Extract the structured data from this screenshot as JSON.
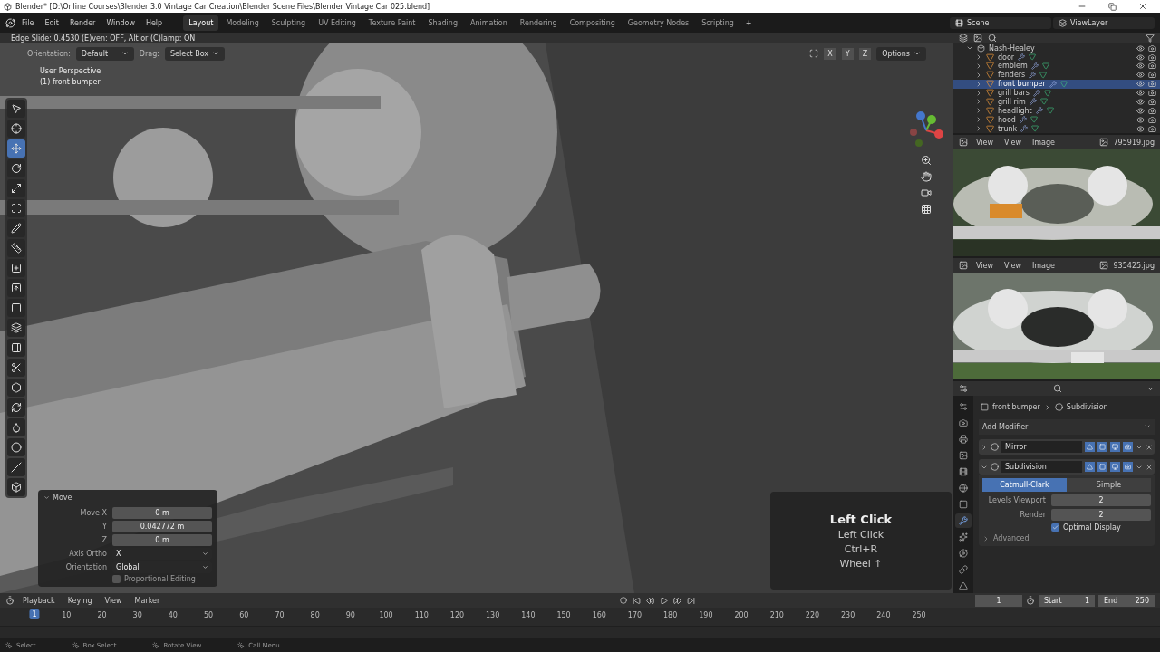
{
  "title_bar": {
    "title": "Blender* [D:\\Online Courses\\Blender 3.0 Vintage Car Creation\\Blender Scene Files\\Blender Vintage Car 025.blend]"
  },
  "menu": [
    "File",
    "Edit",
    "Render",
    "Window",
    "Help"
  ],
  "workspaces": [
    {
      "label": "Layout",
      "selected": true
    },
    {
      "label": "Modeling",
      "selected": false
    },
    {
      "label": "Sculpting",
      "selected": false
    },
    {
      "label": "UV Editing",
      "selected": false
    },
    {
      "label": "Texture Paint",
      "selected": false
    },
    {
      "label": "Shading",
      "selected": false
    },
    {
      "label": "Animation",
      "selected": false
    },
    {
      "label": "Rendering",
      "selected": false
    },
    {
      "label": "Compositing",
      "selected": false
    },
    {
      "label": "Geometry Nodes",
      "selected": false
    },
    {
      "label": "Scripting",
      "selected": false
    }
  ],
  "add_workspace": "+",
  "scene": "Scene",
  "view_layer": "ViewLayer",
  "viewport": {
    "status": "Edge Slide: 0.4530 (E)ven: OFF, Alt or (C)lamp: ON",
    "orientation_label": "Orientation:",
    "orientation": "Default",
    "drag_label": "Drag:",
    "drag": "Select Box",
    "axes": [
      "X",
      "Y",
      "Z"
    ],
    "options": "Options",
    "view_name": "User Perspective",
    "object_info": "(1) front bumper",
    "tools": [
      {
        "kind": "select",
        "selected": false
      },
      {
        "kind": "cursor",
        "selected": false
      },
      {
        "kind": "move",
        "selected": true
      },
      {
        "kind": "rotate",
        "selected": false
      },
      {
        "kind": "scale",
        "selected": false
      },
      {
        "kind": "transform",
        "selected": false
      },
      {
        "kind": "annotate",
        "selected": false
      },
      {
        "kind": "measure",
        "selected": false
      },
      {
        "kind": "add",
        "selected": false
      },
      {
        "kind": "extrude",
        "selected": false
      },
      {
        "kind": "inset",
        "selected": false
      },
      {
        "kind": "bevel",
        "selected": false
      },
      {
        "kind": "loopcut",
        "selected": false
      },
      {
        "kind": "knife",
        "selected": false
      },
      {
        "kind": "polybuild",
        "selected": false
      },
      {
        "kind": "spin",
        "selected": false
      },
      {
        "kind": "smooth",
        "selected": false
      },
      {
        "kind": "shrink",
        "selected": false
      },
      {
        "kind": "shear",
        "selected": false
      },
      {
        "kind": "rip",
        "selected": false
      }
    ]
  },
  "move_panel": {
    "title": "Move",
    "fields": [
      {
        "label": "Move X",
        "value": "0 m"
      },
      {
        "label": "Y",
        "value": "0.042772 m"
      },
      {
        "label": "Z",
        "value": "0 m"
      }
    ],
    "axis_ortho_label": "Axis Ortho",
    "axis_ortho": "X",
    "orientation_label": "Orientation",
    "orientation": "Global",
    "proportional": {
      "label": "Proportional Editing",
      "checked": false
    }
  },
  "keystrokes": {
    "title": "Left Click",
    "lines": [
      "Left Click",
      "Ctrl+R",
      "Wheel ↑"
    ]
  },
  "outliner": {
    "collection": "Nash-Healey",
    "items": [
      {
        "name": "door",
        "selected": false
      },
      {
        "name": "emblem",
        "selected": false
      },
      {
        "name": "fenders",
        "selected": false
      },
      {
        "name": "front bumper",
        "selected": true
      },
      {
        "name": "grill bars",
        "selected": false
      },
      {
        "name": "grill rim",
        "selected": false
      },
      {
        "name": "headlight",
        "selected": false
      },
      {
        "name": "hood",
        "selected": false
      },
      {
        "name": "trunk",
        "selected": false
      }
    ]
  },
  "image_editors": [
    {
      "menus": [
        "View",
        "View",
        "Image"
      ],
      "file": "795919.jpg",
      "kind": "green"
    },
    {
      "menus": [
        "View",
        "View",
        "Image"
      ],
      "file": "935425.jpg",
      "kind": "silver"
    }
  ],
  "properties": {
    "object": "front bumper",
    "modifier": "Subdivision",
    "add_modifier": "Add Modifier",
    "tabs": [
      {
        "kind": "tool",
        "selected": false
      },
      {
        "kind": "render",
        "selected": false
      },
      {
        "kind": "output",
        "selected": false
      },
      {
        "kind": "view",
        "selected": false
      },
      {
        "kind": "scene",
        "selected": false
      },
      {
        "kind": "world",
        "selected": false
      },
      {
        "kind": "object",
        "selected": false
      },
      {
        "kind": "modifiers",
        "selected": true
      },
      {
        "kind": "particles",
        "selected": false
      },
      {
        "kind": "physics",
        "selected": false
      },
      {
        "kind": "constraints",
        "selected": false
      },
      {
        "kind": "data",
        "selected": false
      }
    ],
    "modifiers": [
      {
        "name": "Mirror",
        "expanded": false
      },
      {
        "name": "Subdivision",
        "expanded": true
      }
    ],
    "types": [
      {
        "label": "Catmull-Clark",
        "selected": true
      },
      {
        "label": "Simple",
        "selected": false
      }
    ],
    "fields": [
      {
        "label": "Levels Viewport",
        "value": "2"
      },
      {
        "label": "Render",
        "value": "2"
      }
    ],
    "optimal_display": {
      "label": "Optimal Display",
      "checked": true
    },
    "advanced": "Advanced"
  },
  "timeline": {
    "menus": [
      "Playback",
      "Keying",
      "View",
      "Marker"
    ],
    "current_frame": "1",
    "start_label": "Start",
    "start": "1",
    "end_label": "End",
    "end": "250",
    "playhead": "1",
    "ticks": [
      "10",
      "20",
      "30",
      "40",
      "50",
      "60",
      "70",
      "80",
      "90",
      "100",
      "110",
      "120",
      "130",
      "140",
      "150",
      "160",
      "170",
      "180",
      "190",
      "200",
      "210",
      "220",
      "230",
      "240",
      "250"
    ]
  },
  "status_bar": [
    "Select",
    "Box Select",
    "Rotate View",
    "Call Menu"
  ]
}
